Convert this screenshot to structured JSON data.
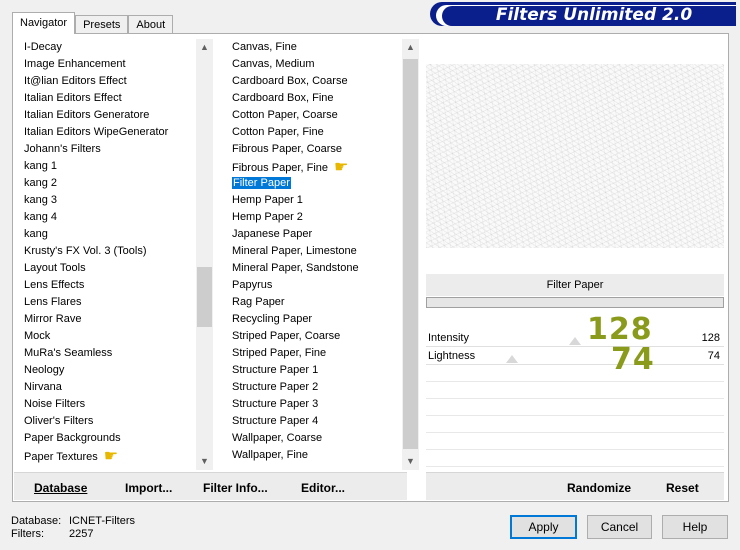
{
  "tabs": [
    "Navigator",
    "Presets",
    "About"
  ],
  "title": "Filters Unlimited 2.0",
  "categories": [
    "I-Decay",
    "Image Enhancement",
    "It@lian Editors Effect",
    "Italian Editors Effect",
    "Italian Editors Generatore",
    "Italian Editors WipeGenerator",
    "Johann's Filters",
    "kang 1",
    "kang 2",
    "kang 3",
    "kang 4",
    "kang",
    "Krusty's FX Vol. 3 (Tools)",
    "Layout Tools",
    "Lens Effects",
    "Lens Flares",
    "Mirror Rave",
    "Mock",
    "MuRa's Seamless",
    "Neology",
    "Nirvana",
    "Noise Filters",
    "Oliver's Filters",
    "Paper Backgrounds",
    "Paper Textures"
  ],
  "filters": [
    "Canvas, Fine",
    "Canvas, Medium",
    "Cardboard Box, Coarse",
    "Cardboard Box, Fine",
    "Cotton Paper, Coarse",
    "Cotton Paper, Fine",
    "Fibrous Paper, Coarse",
    "Fibrous Paper, Fine",
    "Filter Paper",
    "Hemp Paper 1",
    "Hemp Paper 2",
    "Japanese Paper",
    "Mineral Paper, Limestone",
    "Mineral Paper, Sandstone",
    "Papyrus",
    "Rag Paper",
    "Recycling Paper",
    "Striped Paper, Coarse",
    "Striped Paper, Fine",
    "Structure Paper 1",
    "Structure Paper 2",
    "Structure Paper 3",
    "Structure Paper 4",
    "Wallpaper, Coarse",
    "Wallpaper, Fine"
  ],
  "selected_filter": "Filter Paper",
  "filter_header": "Filter Paper",
  "params": [
    {
      "name": "Intensity",
      "value": "128"
    },
    {
      "name": "Lightness",
      "value": "74"
    }
  ],
  "big_values": [
    "128",
    "74"
  ],
  "left_buttons": [
    "Database",
    "Import...",
    "Filter Info...",
    "Editor..."
  ],
  "right_buttons": [
    "Randomize",
    "Reset"
  ],
  "info": {
    "database_label": "Database:",
    "database_value": "ICNET-Filters",
    "filters_label": "Filters:",
    "filters_value": "2257"
  },
  "dialog_buttons": {
    "apply": "Apply",
    "cancel": "Cancel",
    "help": "Help"
  },
  "colors": {
    "accent": "#0078d7",
    "banner": "#0a1e8c",
    "big_number": "#8a9a1a"
  }
}
